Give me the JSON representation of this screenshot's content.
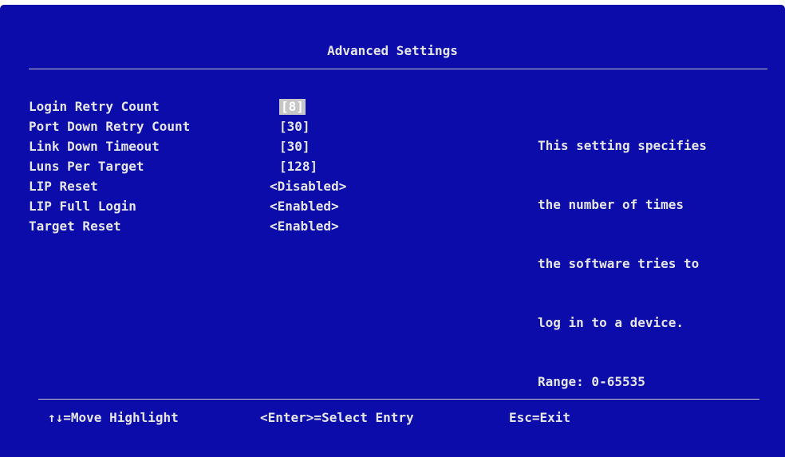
{
  "screen": {
    "title": "Advanced Settings"
  },
  "settings": [
    {
      "label": "Login Retry Count",
      "value": "[8]"
    },
    {
      "label": "Port Down Retry Count",
      "value": "[30]"
    },
    {
      "label": "Link Down Timeout",
      "value": "[30]"
    },
    {
      "label": "Luns Per Target",
      "value": "[128]"
    },
    {
      "label": "LIP Reset",
      "value": "<Disabled>"
    },
    {
      "label": "LIP Full Login",
      "value": "<Enabled>"
    },
    {
      "label": "Target Reset",
      "value": "<Enabled>"
    }
  ],
  "help": {
    "lines": [
      "This setting specifies",
      "the number of times",
      "the software tries to",
      "log in to a device.",
      "Range: 0-65535"
    ]
  },
  "footer": {
    "move": "↑↓=Move Highlight",
    "select": "<Enter>=Select Entry",
    "exit": "Esc=Exit"
  },
  "colors": {
    "background": "#0c0caa",
    "text": "#e6e6e6",
    "highlight": "#c6c6c6"
  }
}
